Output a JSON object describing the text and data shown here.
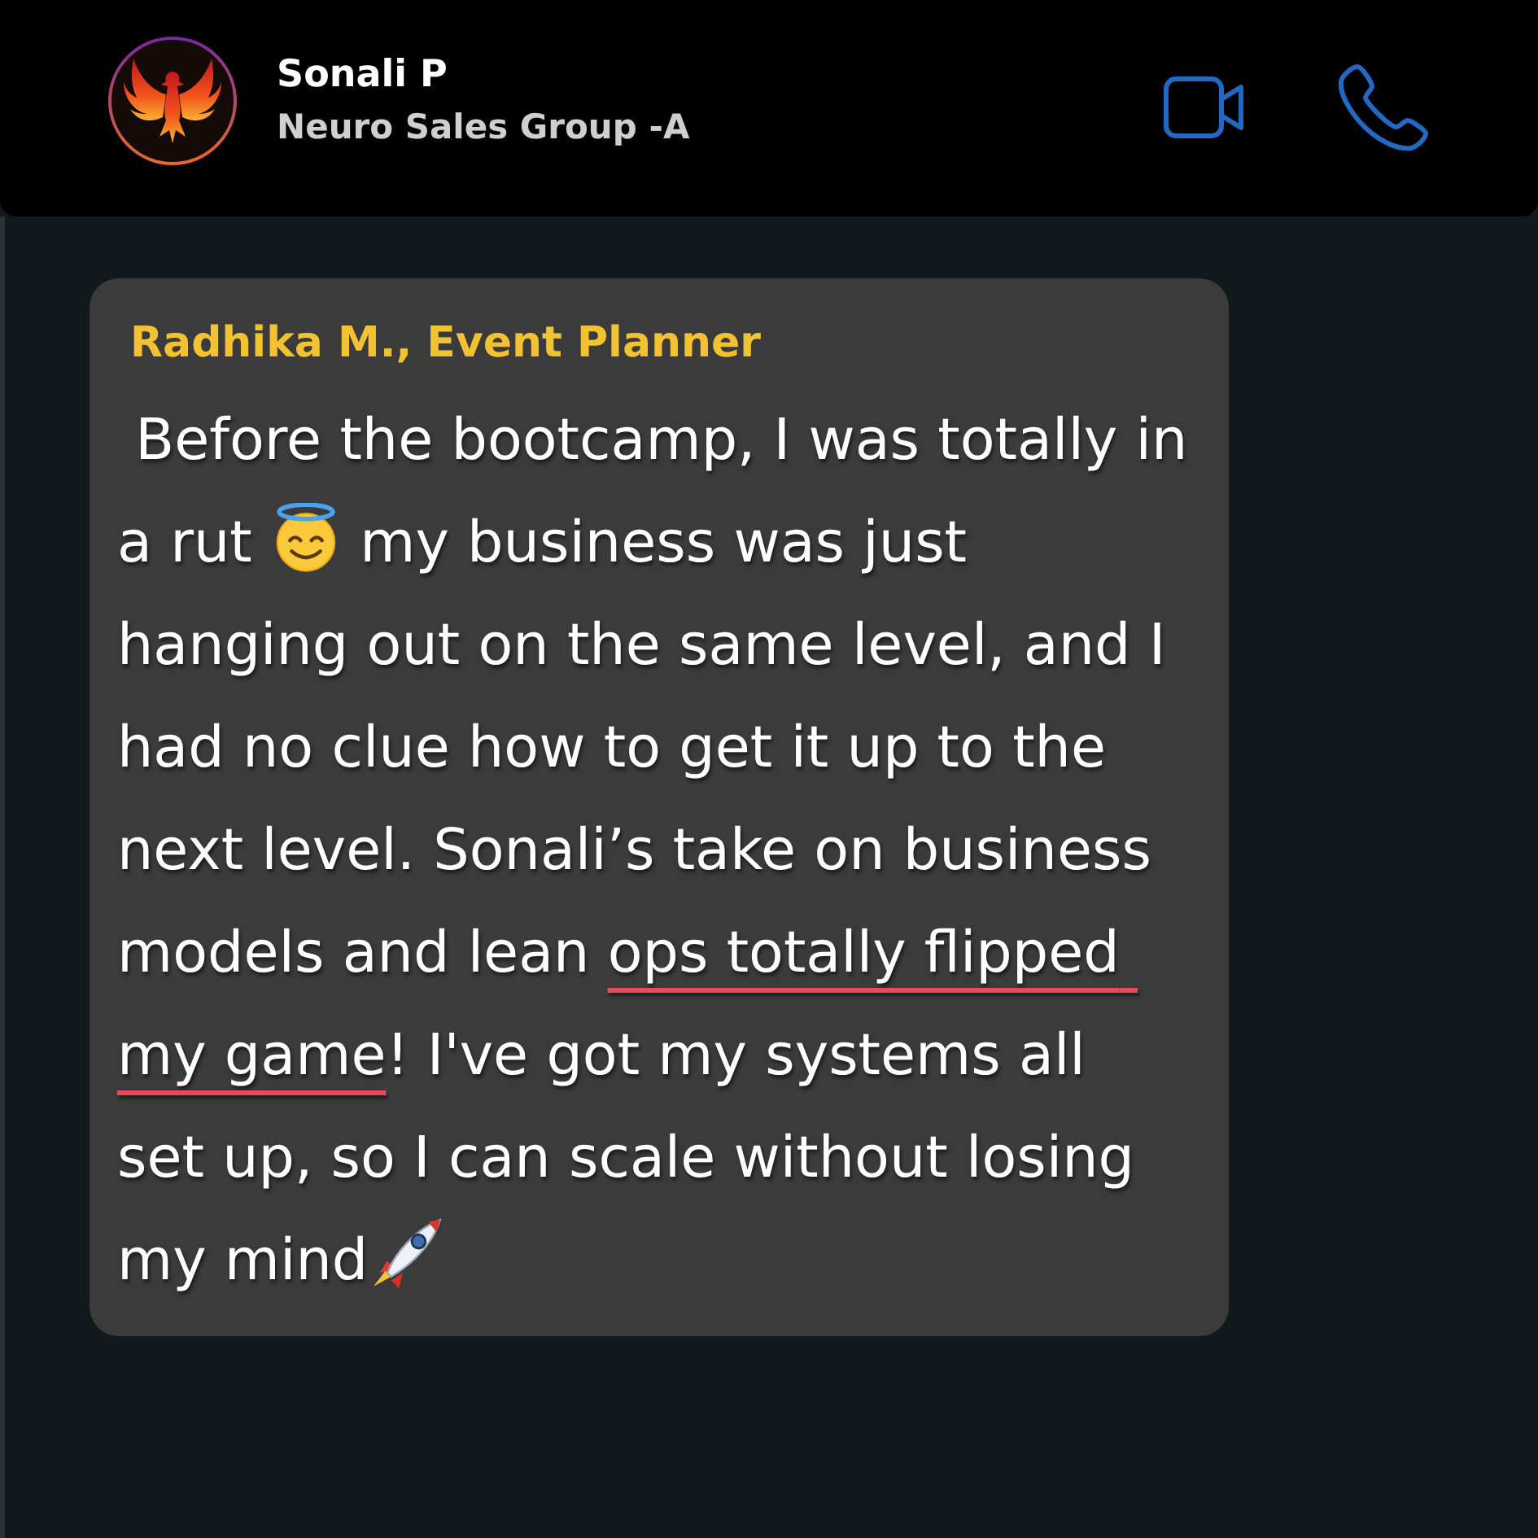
{
  "header": {
    "title": "Sonali P",
    "subtitle": "Neuro Sales Group -A"
  },
  "message": {
    "author": "Radhika M., Event Planner",
    "body": [
      {
        "kind": "text",
        "text": " Before the bootcamp, I was totally in a rut ",
        "underlined": false
      },
      {
        "kind": "emoji"
      },
      {
        "kind": "text",
        "text": " my business was just hanging out on the same level, and I had no clue how to get it up to the next level. Sonali’s take on business models and lean ",
        "underlined": false
      },
      {
        "kind": "text",
        "text": "ops totally flipped my game",
        "underlined": true
      },
      {
        "kind": "text",
        "text": "! I've got my systems all set up, so I can scale without losing my mind",
        "underlined": false
      },
      {
        "kind": "emoji"
      }
    ]
  }
}
